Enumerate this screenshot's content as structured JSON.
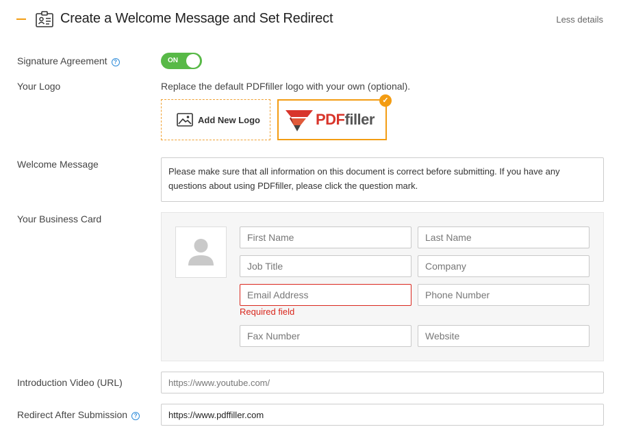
{
  "header": {
    "title": "Create a Welcome Message and Set Redirect",
    "toggle_details": "Less details",
    "icon": "id-card-icon"
  },
  "signature": {
    "label": "Signature Agreement",
    "help_glyph": "?",
    "toggle_text": "ON",
    "enabled": true
  },
  "logo": {
    "label": "Your Logo",
    "hint": "Replace the default PDFfiller logo with your own (optional).",
    "add_button": "Add New Logo",
    "brand_pdf": "PDF",
    "brand_filler": "filler",
    "selected_glyph": "✓"
  },
  "welcome": {
    "label": "Welcome Message",
    "text": "Please make sure that all information on this document is correct before submitting. If you have any questions about using PDFfiller, please click the question mark."
  },
  "business_card": {
    "label": "Your Business Card",
    "first_name": "First Name",
    "last_name": "Last Name",
    "job_title": "Job Title",
    "company": "Company",
    "email": "Email Address",
    "phone": "Phone Number",
    "fax": "Fax Number",
    "website": "Website",
    "error": "Required field"
  },
  "video": {
    "label": "Introduction Video (URL)",
    "placeholder": "https://www.youtube.com/",
    "value": ""
  },
  "redirect": {
    "label": "Redirect After Submission",
    "help_glyph": "?",
    "value": "https://www.pdffiller.com"
  },
  "colors": {
    "accent": "#f39c12",
    "toggle_on": "#58b947",
    "error": "#d9261c",
    "help": "#2b8ad9",
    "brand_red": "#d8352b"
  }
}
